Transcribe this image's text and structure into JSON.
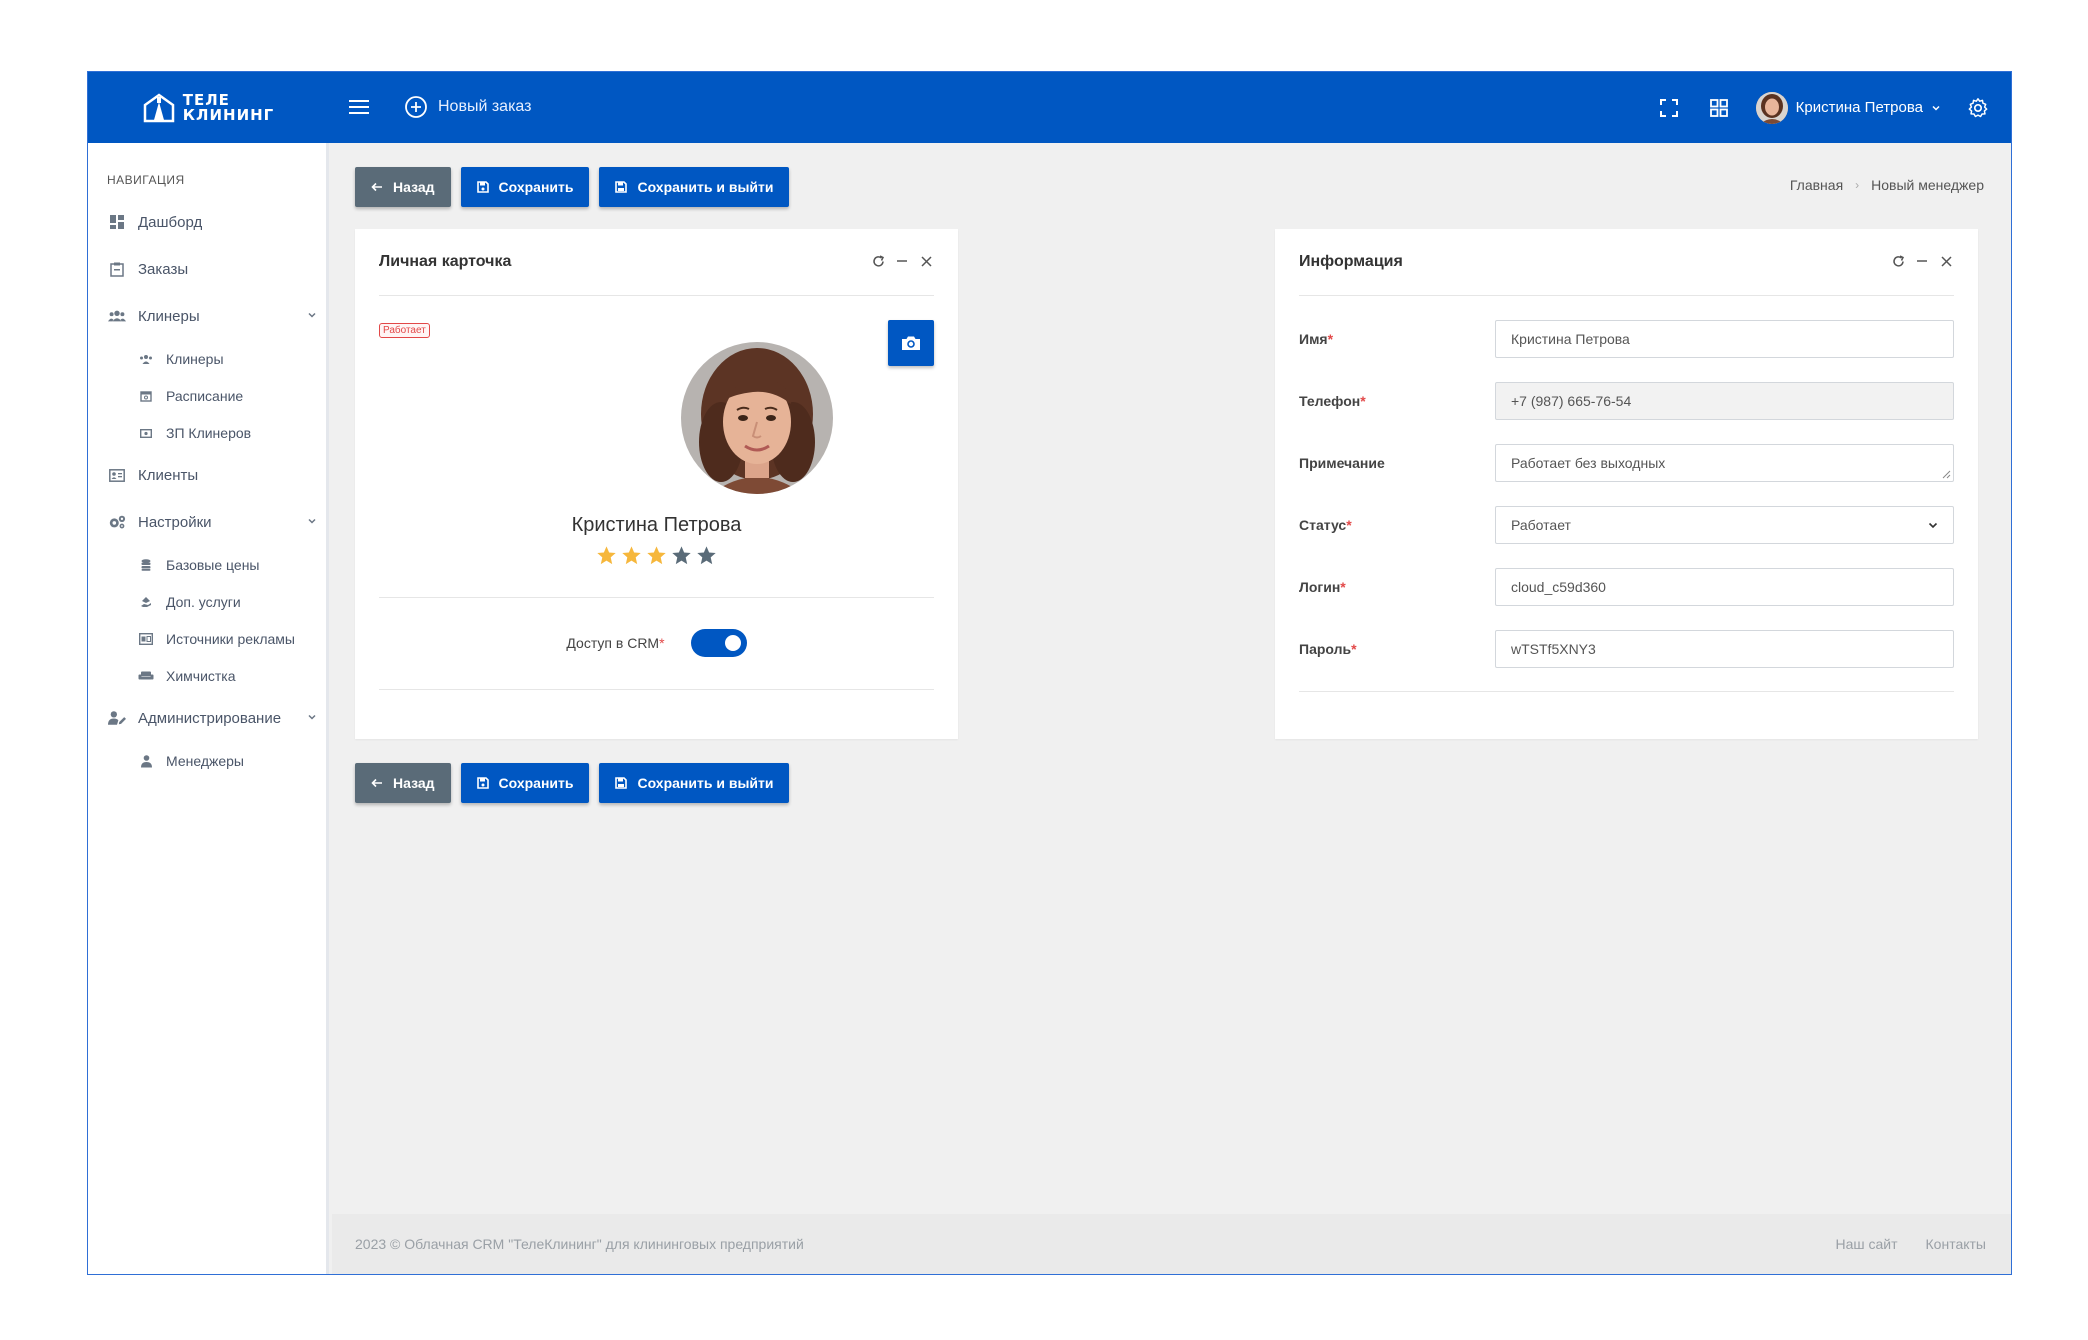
{
  "brand": {
    "line1": "ТЕЛЕ",
    "line2": "КЛИНИНГ"
  },
  "header": {
    "new_order_label": "Новый заказ",
    "user_name": "Кристина Петрова"
  },
  "sidebar": {
    "caption": "Навигация",
    "items": [
      {
        "label": "Дашборд",
        "icon": "dashboard-icon"
      },
      {
        "label": "Заказы",
        "icon": "orders-icon"
      },
      {
        "label": "Клинеры",
        "icon": "users-icon",
        "expanded": true,
        "children": [
          {
            "label": "Клинеры",
            "icon": "users-small-icon"
          },
          {
            "label": "Расписание",
            "icon": "calendar-icon"
          },
          {
            "label": "ЗП Клинеров",
            "icon": "money-icon"
          }
        ]
      },
      {
        "label": "Клиенты",
        "icon": "address-card-icon"
      },
      {
        "label": "Настройки",
        "icon": "cogs-icon",
        "expanded": true,
        "children": [
          {
            "label": "Базовые цены",
            "icon": "database-icon"
          },
          {
            "label": "Доп. услуги",
            "icon": "hand-icon"
          },
          {
            "label": "Источники рекламы",
            "icon": "ad-icon"
          },
          {
            "label": "Химчистка",
            "icon": "couch-icon"
          }
        ]
      },
      {
        "label": "Администрирование",
        "icon": "user-edit-icon",
        "expanded": true,
        "children": [
          {
            "label": "Менеджеры",
            "icon": "user-icon"
          }
        ]
      }
    ]
  },
  "toolbar": {
    "back_label": "Назад",
    "save_label": "Сохранить",
    "save_exit_label": "Сохранить и выйти"
  },
  "breadcrumb": [
    "Главная",
    "Новый менеджер"
  ],
  "profile_card": {
    "title": "Личная карточка",
    "status_badge": "Работает",
    "name": "Кристина Петрова",
    "rating": 3,
    "rating_max": 5,
    "crm_access_label": "Доступ в CRM",
    "crm_access_enabled": true
  },
  "info_card": {
    "title": "Информация",
    "fields": {
      "name": {
        "label": "Имя",
        "value": "Кристина Петрова"
      },
      "phone": {
        "label": "Телефон",
        "value": "+7 (987) 665-76-54"
      },
      "note": {
        "label": "Примечание",
        "value": "Работает без выходных"
      },
      "status": {
        "label": "Статус",
        "value": "Работает"
      },
      "login": {
        "label": "Логин",
        "value": "cloud_c59d360"
      },
      "password": {
        "label": "Пароль",
        "value": "wTSTf5XNY3"
      }
    }
  },
  "footer": {
    "copyright": "2023 © Облачная CRM \"ТелеКлининг\" для клининговых предприятий",
    "links": [
      "Наш сайт",
      "Контакты"
    ]
  },
  "colors": {
    "primary": "#0057c2",
    "back_button": "#5a6b78",
    "required": "#e24848",
    "star_filled": "#f6b73c",
    "star_empty": "#5a6b78"
  }
}
